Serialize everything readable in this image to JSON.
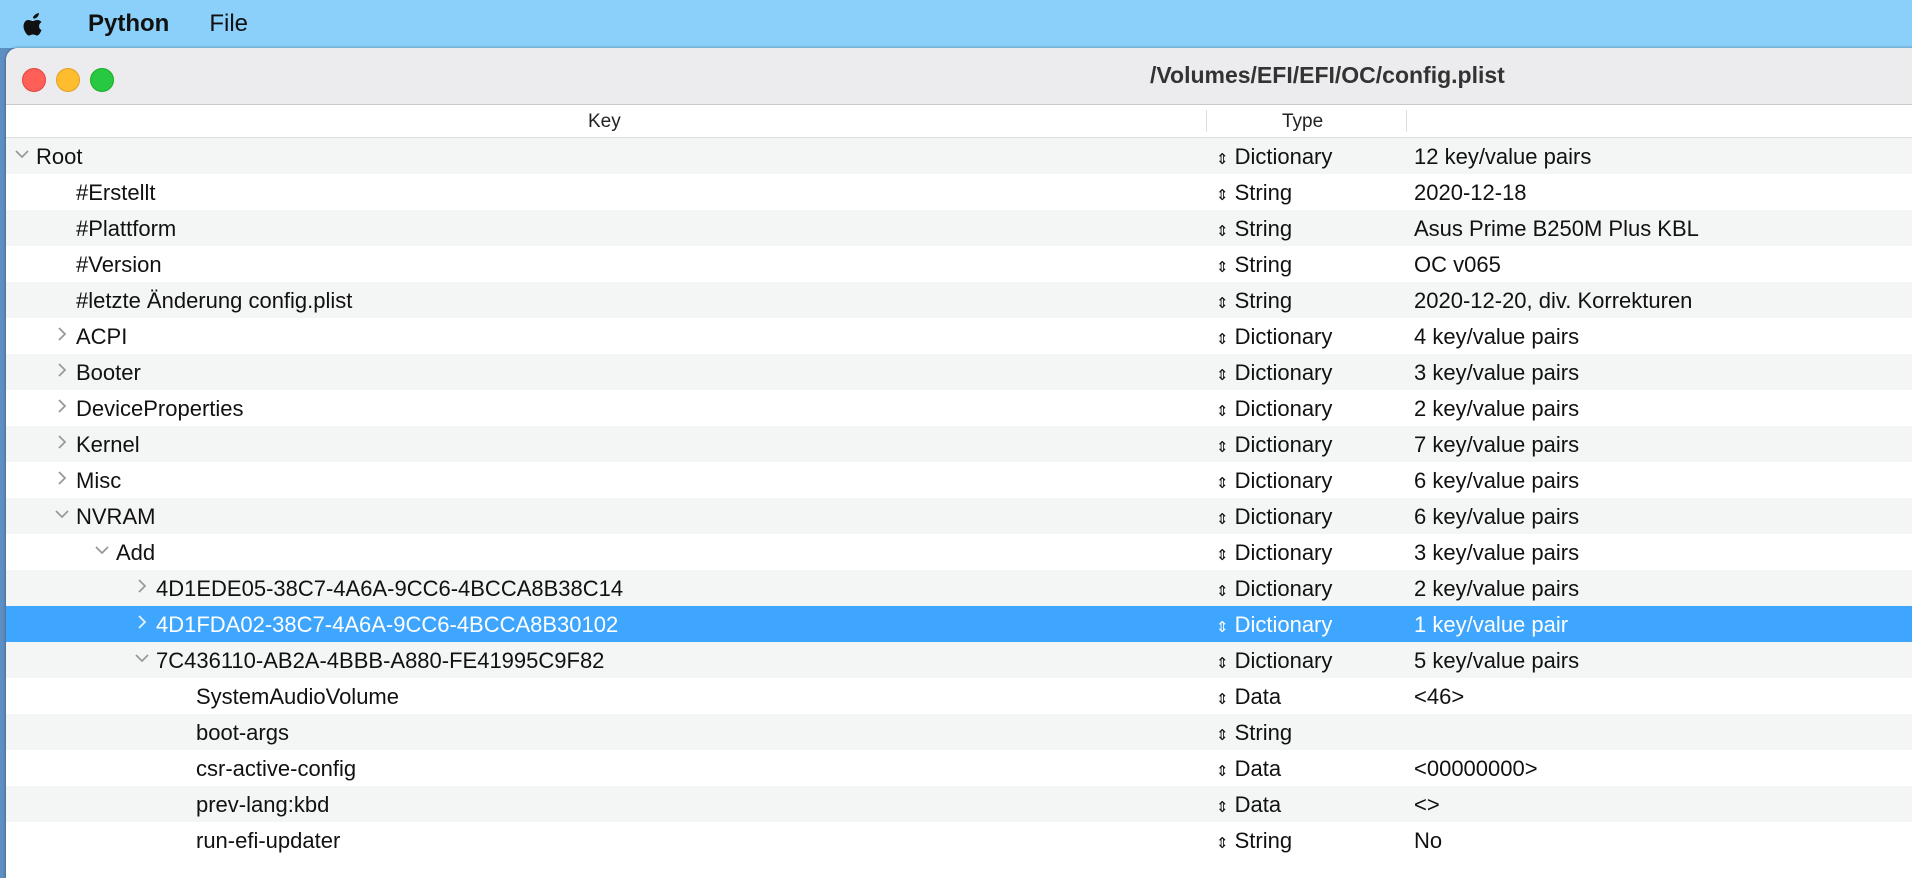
{
  "menubar": {
    "app": "Python",
    "items": [
      "File"
    ]
  },
  "window": {
    "title": "/Volumes/EFI/EFI/OC/config.plist"
  },
  "columns": {
    "key": "Key",
    "type": "Type"
  },
  "rows": [
    {
      "key": "Root",
      "type": "Dictionary",
      "value": "12 key/value pairs",
      "level": 0,
      "chevron": "down"
    },
    {
      "key": "#Erstellt",
      "type": "String",
      "value": "2020-12-18",
      "level": 1,
      "chevron": ""
    },
    {
      "key": "#Plattform",
      "type": "String",
      "value": "Asus Prime B250M Plus KBL",
      "level": 1,
      "chevron": ""
    },
    {
      "key": "#Version",
      "type": "String",
      "value": "OC  v065",
      "level": 1,
      "chevron": ""
    },
    {
      "key": "#letzte Änderung config.plist",
      "type": "String",
      "value": "2020-12-20, div. Korrekturen",
      "level": 1,
      "chevron": ""
    },
    {
      "key": "ACPI",
      "type": "Dictionary",
      "value": "4 key/value pairs",
      "level": 1,
      "chevron": "right"
    },
    {
      "key": "Booter",
      "type": "Dictionary",
      "value": "3 key/value pairs",
      "level": 1,
      "chevron": "right"
    },
    {
      "key": "DeviceProperties",
      "type": "Dictionary",
      "value": "2 key/value pairs",
      "level": 1,
      "chevron": "right"
    },
    {
      "key": "Kernel",
      "type": "Dictionary",
      "value": "7 key/value pairs",
      "level": 1,
      "chevron": "right"
    },
    {
      "key": "Misc",
      "type": "Dictionary",
      "value": "6 key/value pairs",
      "level": 1,
      "chevron": "right"
    },
    {
      "key": "NVRAM",
      "type": "Dictionary",
      "value": "6 key/value pairs",
      "level": 1,
      "chevron": "down"
    },
    {
      "key": "Add",
      "type": "Dictionary",
      "value": "3 key/value pairs",
      "level": 2,
      "chevron": "down"
    },
    {
      "key": "4D1EDE05-38C7-4A6A-9CC6-4BCCA8B38C14",
      "type": "Dictionary",
      "value": "2 key/value pairs",
      "level": 3,
      "chevron": "right"
    },
    {
      "key": "4D1FDA02-38C7-4A6A-9CC6-4BCCA8B30102",
      "type": "Dictionary",
      "value": "1 key/value pair",
      "level": 3,
      "chevron": "right",
      "selected": true
    },
    {
      "key": "7C436110-AB2A-4BBB-A880-FE41995C9F82",
      "type": "Dictionary",
      "value": "5 key/value pairs",
      "level": 3,
      "chevron": "down"
    },
    {
      "key": "SystemAudioVolume",
      "type": "Data",
      "value": "<46>",
      "level": 4,
      "chevron": ""
    },
    {
      "key": "boot-args",
      "type": "String",
      "value": "",
      "level": 4,
      "chevron": ""
    },
    {
      "key": "csr-active-config",
      "type": "Data",
      "value": "<00000000>",
      "level": 4,
      "chevron": ""
    },
    {
      "key": "prev-lang:kbd",
      "type": "Data",
      "value": "<>",
      "level": 4,
      "chevron": ""
    },
    {
      "key": "run-efi-updater",
      "type": "String",
      "value": "No",
      "level": 4,
      "chevron": ""
    }
  ],
  "colors": {
    "menubar": "#8bd0fa",
    "selection": "#3ea6fe",
    "close": "#fe5f57",
    "minimize": "#febc2e",
    "zoom": "#28c840"
  }
}
